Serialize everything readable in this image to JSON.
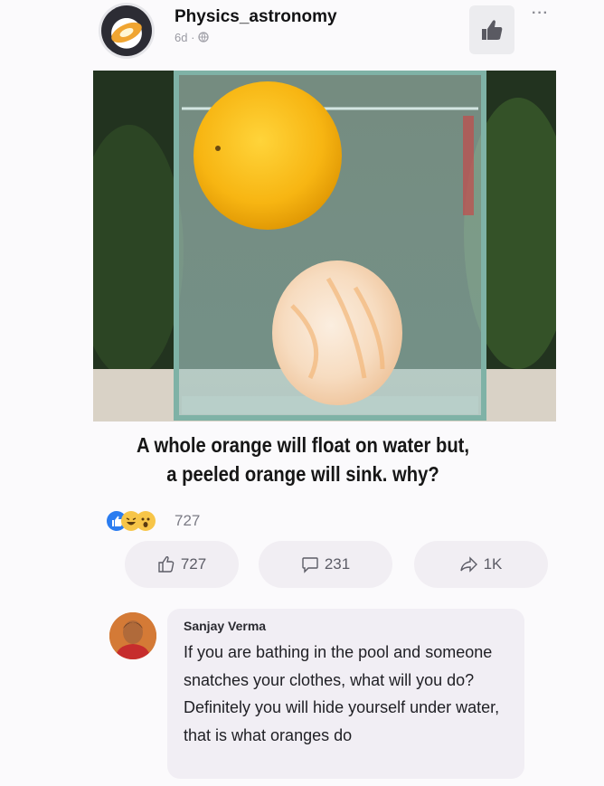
{
  "post": {
    "page_name": "Physics_astronomy",
    "meta": "6d · ",
    "privacy_icon": "globe-icon",
    "more_label": "···",
    "caption_line1": "A whole orange will float on water but,",
    "caption_line2": "a peeled orange will sink. why?"
  },
  "reactions": {
    "icons": [
      "like",
      "haha",
      "wow"
    ],
    "count": "727"
  },
  "actions": {
    "like_count": "727",
    "comment_count": "231",
    "share_count": "1K"
  },
  "comment": {
    "author": "Sanjay Verma",
    "text": "If you are bathing in the pool and someone snatches your clothes, what will you do? Definitely you will hide yourself under water, that is what oranges do"
  },
  "colors": {
    "like_blue": "#2a7cf0",
    "reaction_yellow": "#f7c548",
    "pill_bg": "#f1eef3",
    "bubble_bg": "#f1eef4"
  }
}
